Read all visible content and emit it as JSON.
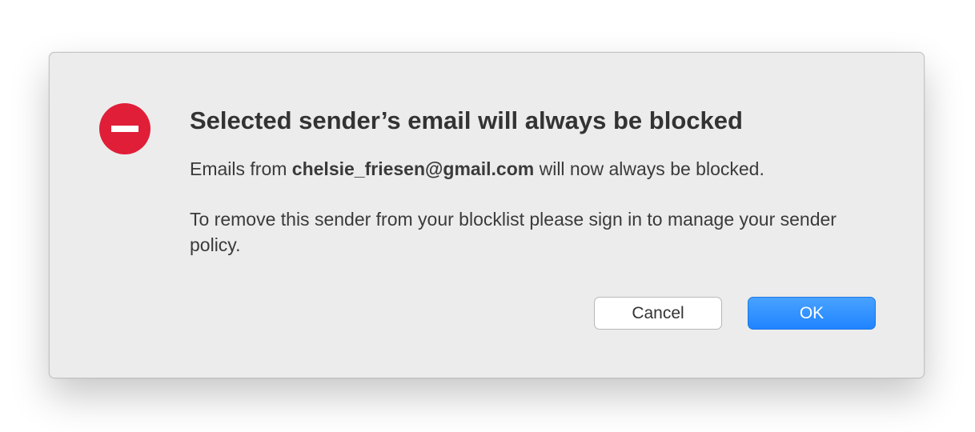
{
  "dialog": {
    "title": "Selected sender’s email will always be blocked",
    "message": {
      "prefix": "Emails from ",
      "email": "chelsie_friesen@gmail.com",
      "suffix": " will now always be blocked."
    },
    "instructions": "To remove this sender from your blocklist please sign in to manage your sender policy.",
    "icon": "stop-icon",
    "accent_color": "#e01e38"
  },
  "buttons": {
    "cancel_label": "Cancel",
    "ok_label": "OK",
    "ok_color": "#2a8bff"
  }
}
